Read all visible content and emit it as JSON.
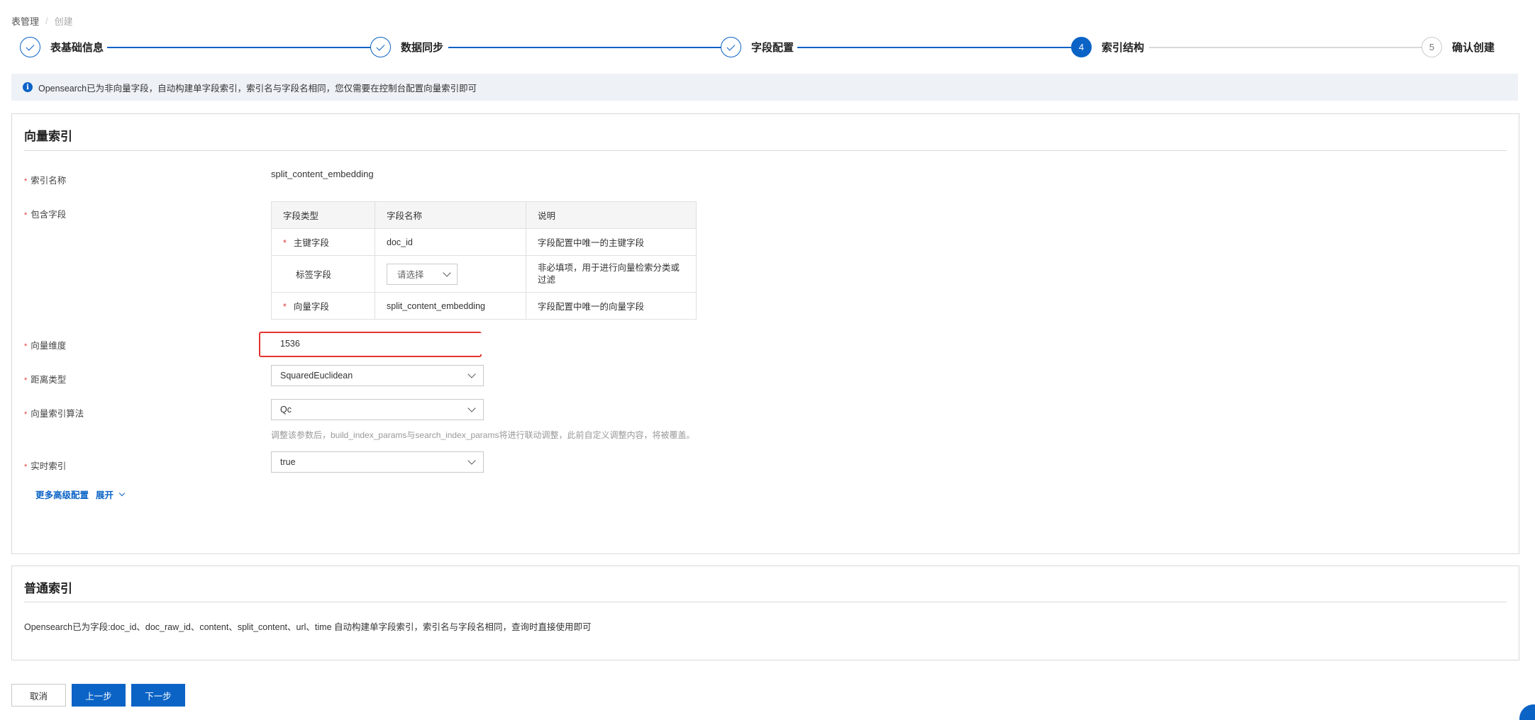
{
  "breadcrumb": {
    "parent": "表管理",
    "separator": "/",
    "current": "创建"
  },
  "steps": [
    {
      "label": "表基础信息",
      "status": "done",
      "number": "1"
    },
    {
      "label": "数据同步",
      "status": "done",
      "number": "2"
    },
    {
      "label": "字段配置",
      "status": "done",
      "number": "3"
    },
    {
      "label": "索引结构",
      "status": "active",
      "number": "4"
    },
    {
      "label": "确认创建",
      "status": "pending",
      "number": "5"
    }
  ],
  "alert": {
    "icon": "info-icon",
    "text": "Opensearch已为非向量字段，自动构建单字段索引，索引名与字段名相同，您仅需要在控制台配置向量索引即可"
  },
  "vector_index": {
    "title": "向量索引",
    "index_name_label": "索引名称",
    "index_name_value": "split_content_embedding",
    "fields_label": "包含字段",
    "table": {
      "headers": [
        "字段类型",
        "字段名称",
        "说明"
      ],
      "rows": [
        {
          "required": "*",
          "type": "主键字段",
          "name": "doc_id",
          "desc": "字段配置中唯一的主键字段"
        },
        {
          "required": "",
          "type": "标签字段",
          "select_placeholder": "请选择",
          "desc": "非必填项，用于进行向量检索分类或过滤"
        },
        {
          "required": "*",
          "type": "向量字段",
          "name": "split_content_embedding",
          "desc": "字段配置中唯一的向量字段"
        }
      ]
    },
    "dimension_label": "向量维度",
    "dimension_value": "1536",
    "distance_label": "距离类型",
    "distance_value": "SquaredEuclidean",
    "algorithm_label": "向量索引算法",
    "algorithm_value": "Qc",
    "algorithm_hint": "调整该参数后，build_index_params与search_index_params将进行联动调整，此前自定义调整内容，将被覆盖。",
    "realtime_label": "实时索引",
    "realtime_value": "true",
    "advanced_label": "更多高级配置",
    "advanced_toggle": "展开",
    "required_mark": "*"
  },
  "normal_index": {
    "title": "普通索引",
    "text": "Opensearch已为字段:doc_id、doc_raw_id、content、split_content、url、time 自动构建单字段索引，索引名与字段名相同，查询时直接使用即可"
  },
  "buttons": {
    "cancel": "取消",
    "prev": "上一步",
    "next": "下一步"
  },
  "colors": {
    "primary": "#0b63c6",
    "required": "#e43c3c",
    "highlight": "#e3342f",
    "alert_bg": "#eef2f7"
  }
}
